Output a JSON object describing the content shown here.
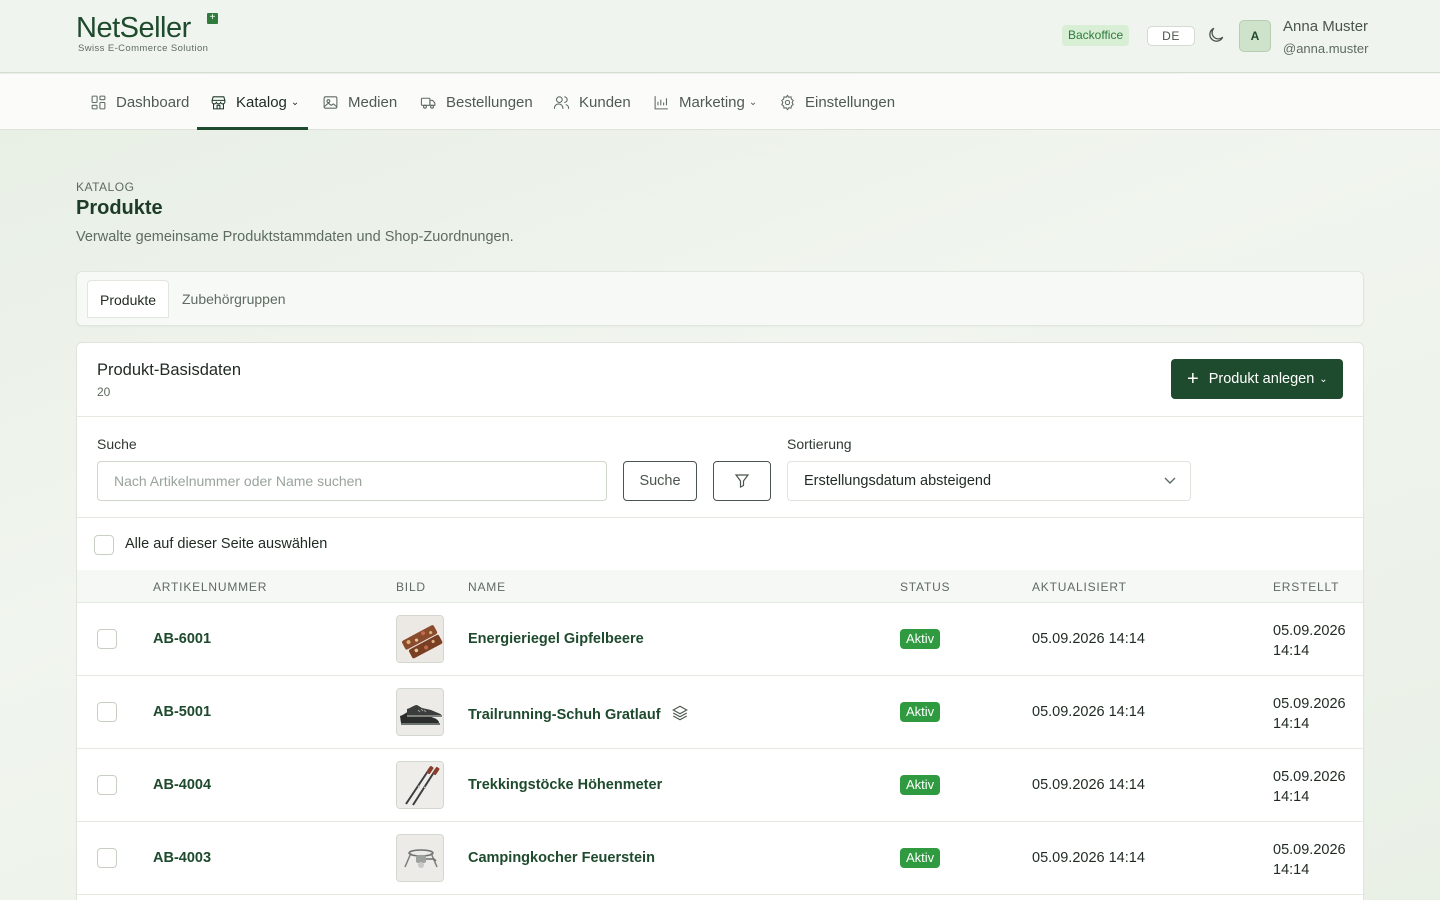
{
  "brand": {
    "logo_text": "NetSeller",
    "tagline": "Swiss E-Commerce Solution"
  },
  "header": {
    "env_badge": "Backoffice",
    "language": "DE",
    "user": {
      "initial": "A",
      "name": "Anna Muster",
      "handle": "@anna.muster"
    }
  },
  "nav": {
    "items": [
      {
        "label": "Dashboard",
        "icon": "dashboard-icon"
      },
      {
        "label": "Katalog",
        "icon": "store-icon",
        "active": true,
        "dropdown": true
      },
      {
        "label": "Medien",
        "icon": "image-icon"
      },
      {
        "label": "Bestellungen",
        "icon": "truck-icon"
      },
      {
        "label": "Kunden",
        "icon": "users-icon"
      },
      {
        "label": "Marketing",
        "icon": "chart-icon",
        "dropdown": true
      },
      {
        "label": "Einstellungen",
        "icon": "gear-icon"
      }
    ]
  },
  "page": {
    "eyebrow": "KATALOG",
    "title": "Produkte",
    "description": "Verwalte gemeinsame Produktstammdaten und Shop-Zuordnungen."
  },
  "tabs": [
    {
      "label": "Produkte",
      "active": true
    },
    {
      "label": "Zubehörgruppen",
      "active": false
    }
  ],
  "card": {
    "title": "Produkt-Basisdaten",
    "count": "20",
    "create_button": "Produkt anlegen",
    "search_label": "Suche",
    "search_placeholder": "Nach Artikelnummer oder Name suchen",
    "search_button": "Suche",
    "sort_label": "Sortierung",
    "sort_value": "Erstellungsdatum absteigend",
    "select_all_label": "Alle auf dieser Seite auswählen"
  },
  "table": {
    "columns": [
      "ARTIKELNUMMER",
      "BILD",
      "NAME",
      "STATUS",
      "AKTUALISIERT",
      "ERSTELLT"
    ],
    "rows": [
      {
        "sku": "AB-6001",
        "name": "Energieriegel Gipfelbeere",
        "status": "Aktiv",
        "updated": "05.09.2026 14:14",
        "created_date": "05.09.2026",
        "created_time": "14:14",
        "image": "energy-bar",
        "variants": false
      },
      {
        "sku": "AB-5001",
        "name": "Trailrunning-Schuh Gratlauf",
        "status": "Aktiv",
        "updated": "05.09.2026 14:14",
        "created_date": "05.09.2026",
        "created_time": "14:14",
        "image": "running-shoe",
        "variants": true
      },
      {
        "sku": "AB-4004",
        "name": "Trekkingstöcke Höhenmeter",
        "status": "Aktiv",
        "updated": "05.09.2026 14:14",
        "created_date": "05.09.2026",
        "created_time": "14:14",
        "image": "trekking-poles",
        "variants": false
      },
      {
        "sku": "AB-4003",
        "name": "Campingkocher Feuerstein",
        "status": "Aktiv",
        "updated": "05.09.2026 14:14",
        "created_date": "05.09.2026",
        "created_time": "14:14",
        "image": "camping-stove",
        "variants": false
      }
    ]
  },
  "colors": {
    "brand": "#1e4a2d",
    "status_active": "#2f9a3f",
    "badge_bg": "#d8efd6"
  }
}
